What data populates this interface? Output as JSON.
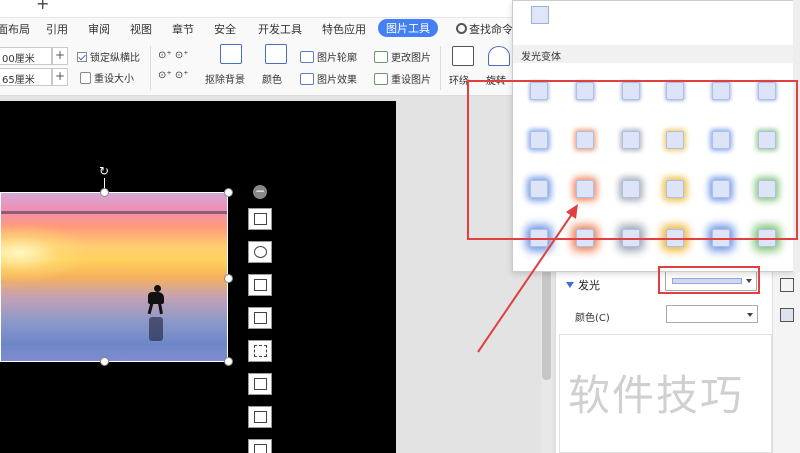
{
  "tabs": {
    "add": "+"
  },
  "menu": {
    "items": [
      "页面布局",
      "引用",
      "审阅",
      "视图",
      "章节",
      "安全",
      "开发工具",
      "特色应用",
      "图片工具"
    ],
    "active_index": 8,
    "search": "查找命令、"
  },
  "ribbon": {
    "width_value": "00厘米",
    "height_value": "65厘米",
    "spin_plus": "+",
    "lock_ratio": "锁定纵横比",
    "reset_size": "重设大小",
    "remove_bg": "抠除背景",
    "color": "颜色",
    "outline": "图片轮廓",
    "effects": "图片效果",
    "change_pic": "更改图片",
    "reset_pic": "重设图片",
    "wrap": "环绕",
    "rotate": "旋转"
  },
  "dropdown": {
    "section_title": "发光变体",
    "glow_rows": [
      [
        "#aab8e6",
        "#aab8e6",
        "#aab8e6",
        "#aab8e6",
        "#aab8e6",
        "#aab8e6"
      ],
      [
        "#8fb0f0",
        "#f4a882",
        "#b7bdc7",
        "#f2cf6e",
        "#8fb0f0",
        "#9fd19a"
      ],
      [
        "#7aa0e8",
        "#f08f6a",
        "#a9b0bd",
        "#efc04c",
        "#7aa0e8",
        "#8cc984"
      ],
      [
        "#6b94e4",
        "#ee7f55",
        "#9aa2b1",
        "#ecb63a",
        "#6b94e4",
        "#7cc273"
      ]
    ]
  },
  "panel": {
    "glow_label": "发光",
    "color_label": "颜色(C)",
    "watermark": "软件技巧"
  },
  "colors": {
    "accent": "#4480f5",
    "annotation": "#e04040"
  }
}
